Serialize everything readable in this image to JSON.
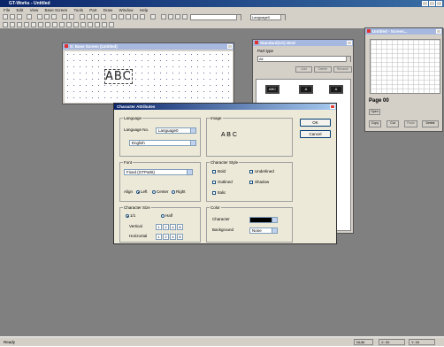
{
  "app": {
    "title": "GT-Works - Untitled",
    "menus": [
      "File",
      "Edit",
      "View",
      "Base Screen",
      "Tools",
      "Part",
      "Draw",
      "Window",
      "Help"
    ]
  },
  "toolbar": {
    "zoom_combo": "",
    "lang_combo": "Language0"
  },
  "screen_window": {
    "title": "S: Base Screen (Untitled)",
    "sample_text": "ABC"
  },
  "part_window": {
    "title": "Standard(1/1) Wnd",
    "part_type_label": "Part type",
    "part_type_value": "All",
    "buttons": [
      "Add",
      "Delete",
      "Rename"
    ]
  },
  "library_window": {
    "title": "Untitled - Screen...",
    "page_label": "Page 00",
    "buttons": [
      "Copy",
      "Cut",
      "Paste",
      "Delete"
    ],
    "open_label": "Open"
  },
  "dialog": {
    "title": "Character Attributes",
    "language_group": "Language",
    "language_no_label": "Language No.",
    "language_no_value": "Language0",
    "language_value": "English",
    "image_group": "Image",
    "image_preview": "A B C",
    "font_group": "Font",
    "font_value": "Fixed (GTPa06)",
    "align_label": "Align",
    "align_options": [
      "Left",
      "Center",
      "Right"
    ],
    "char_style_group": "Character Style",
    "style_options": [
      "Bold",
      "Underlined",
      "Outlined",
      "Shadow",
      "Italic"
    ],
    "char_size_group": "Character Size",
    "size_options": [
      "1/1",
      "Half"
    ],
    "vertical_label": "Vertical",
    "horizontal_label": "Horizontal",
    "vertical_values": [
      "1",
      "2",
      "4",
      "8"
    ],
    "horizontal_values": [
      "1",
      "2",
      "4",
      "8"
    ],
    "color_group": "Color",
    "character_label": "Character",
    "background_label": "Background",
    "background_value": "None",
    "ok_label": "OK",
    "cancel_label": "Cancel"
  },
  "status": {
    "text": "Ready",
    "cells": [
      "NUM",
      "X: 00",
      "Y: 00"
    ]
  }
}
